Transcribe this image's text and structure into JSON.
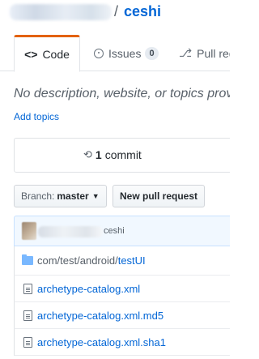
{
  "repo": {
    "separator": "/",
    "name": "ceshi"
  },
  "tabs": [
    {
      "icon": "<>",
      "label": "Code"
    },
    {
      "label": "Issues",
      "count": "0"
    },
    {
      "icon": "⎇",
      "label": "Pull req"
    }
  ],
  "description": "No description, website, or topics provid",
  "add_topics": "Add topics",
  "commits": {
    "count": "1",
    "label": "commit"
  },
  "branch": {
    "label": "Branch:",
    "name": "master"
  },
  "new_pr_label": "New pull request",
  "latest_commit": {
    "message": "ceshi"
  },
  "files": [
    {
      "type": "folder",
      "prefix": "com/test/android/",
      "name": "testUI"
    },
    {
      "type": "file",
      "name": "archetype-catalog.xml"
    },
    {
      "type": "file",
      "name": "archetype-catalog.xml.md5"
    },
    {
      "type": "file",
      "name": "archetype-catalog.xml.sha1"
    }
  ],
  "colors": {
    "accent": "#e36209",
    "link": "#0366d6",
    "folder": "#79b8ff"
  }
}
